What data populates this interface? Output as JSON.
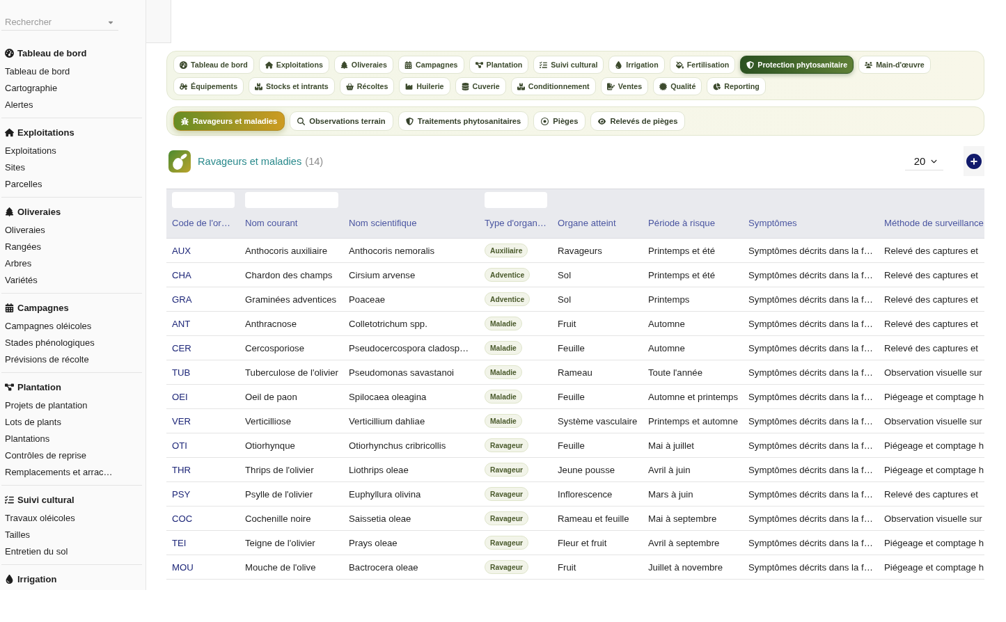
{
  "sidebar": {
    "search": {
      "placeholder": "Rechercher"
    },
    "sections": [
      {
        "title": "Tableau de bord",
        "items": [
          "Tableau de bord",
          "Cartographie",
          "Alertes"
        ]
      },
      {
        "title": "Exploitations",
        "items": [
          "Exploitations",
          "Sites",
          "Parcelles"
        ]
      },
      {
        "title": "Oliveraies",
        "items": [
          "Oliveraies",
          "Rangées",
          "Arbres",
          "Variétés"
        ]
      },
      {
        "title": "Campagnes",
        "items": [
          "Campagnes oléicoles",
          "Stades phénologiques",
          "Prévisions de récolte"
        ]
      },
      {
        "title": "Plantation",
        "items": [
          "Projets de plantation",
          "Lots de plants",
          "Plantations",
          "Contrôles de reprise",
          "Remplacements et arrac…"
        ]
      },
      {
        "title": "Suivi cultural",
        "items": [
          "Travaux oléicoles",
          "Tailles",
          "Entretien du sol"
        ]
      },
      {
        "title": "Irrigation"
      }
    ]
  },
  "module_tabs": [
    {
      "label": "Tableau de bord",
      "selected": false
    },
    {
      "label": "Exploitations",
      "selected": false
    },
    {
      "label": "Oliveraies",
      "selected": false
    },
    {
      "label": "Campagnes",
      "selected": false
    },
    {
      "label": "Plantation",
      "selected": false
    },
    {
      "label": "Suivi cultural",
      "selected": false
    },
    {
      "label": "Irrigation",
      "selected": false
    },
    {
      "label": "Fertilisation",
      "selected": false
    },
    {
      "label": "Protection phytosanitaire",
      "selected": true
    },
    {
      "label": "Main-d'œuvre",
      "selected": false
    },
    {
      "label": "Équipements",
      "selected": false
    },
    {
      "label": "Stocks et intrants",
      "selected": false
    },
    {
      "label": "Récoltes",
      "selected": false
    },
    {
      "label": "Huilerie",
      "selected": false
    },
    {
      "label": "Cuverie",
      "selected": false
    },
    {
      "label": "Conditionnement",
      "selected": false
    },
    {
      "label": "Ventes",
      "selected": false
    },
    {
      "label": "Qualité",
      "selected": false
    },
    {
      "label": "Reporting",
      "selected": false
    }
  ],
  "sub_tabs": [
    {
      "label": "Ravageurs et maladies",
      "selected": true
    },
    {
      "label": "Observations terrain",
      "selected": false
    },
    {
      "label": "Traitements phytosanitaires",
      "selected": false
    },
    {
      "label": "Pièges",
      "selected": false
    },
    {
      "label": "Relevés de pièges",
      "selected": false
    }
  ],
  "list_header": {
    "title": "Ravageurs et maladies",
    "count": "(14)",
    "page_size": "20"
  },
  "table": {
    "columns": [
      {
        "label": "Code de l'or…",
        "filter": true,
        "kind": "link"
      },
      {
        "label": "Nom courant",
        "filter": true,
        "kind": "text"
      },
      {
        "label": "Nom scientifique",
        "filter": false,
        "kind": "text"
      },
      {
        "label": "Type d'organ…",
        "filter": true,
        "kind": "badge"
      },
      {
        "label": "Organe atteint",
        "filter": false,
        "kind": "text"
      },
      {
        "label": "Période à risque",
        "filter": false,
        "kind": "text"
      },
      {
        "label": "Symptômes",
        "filter": false,
        "kind": "text"
      },
      {
        "label": "Méthode de surveillance",
        "filter": false,
        "kind": "text"
      }
    ],
    "rows": [
      [
        "AUX",
        "Anthocoris auxiliaire",
        "Anthocoris nemoralis",
        "Auxiliaire",
        "Ravageurs",
        "Printemps et été",
        "Symptômes décrits dans la f…",
        "Relevé des captures et"
      ],
      [
        "CHA",
        "Chardon des champs",
        "Cirsium arvense",
        "Adventice",
        "Sol",
        "Printemps et été",
        "Symptômes décrits dans la f…",
        "Relevé des captures et"
      ],
      [
        "GRA",
        "Graminées adventices",
        "Poaceae",
        "Adventice",
        "Sol",
        "Printemps",
        "Symptômes décrits dans la f…",
        "Relevé des captures et"
      ],
      [
        "ANT",
        "Anthracnose",
        "Colletotrichum spp.",
        "Maladie",
        "Fruit",
        "Automne",
        "Symptômes décrits dans la f…",
        "Relevé des captures et"
      ],
      [
        "CER",
        "Cercosporiose",
        "Pseudocercospora cladosp…",
        "Maladie",
        "Feuille",
        "Automne",
        "Symptômes décrits dans la f…",
        "Relevé des captures et"
      ],
      [
        "TUB",
        "Tuberculose de l'olivier",
        "Pseudomonas savastanoi",
        "Maladie",
        "Rameau",
        "Toute l'année",
        "Symptômes décrits dans la f…",
        "Observation visuelle sur"
      ],
      [
        "OEI",
        "Oeil de paon",
        "Spilocaea oleagina",
        "Maladie",
        "Feuille",
        "Automne et printemps",
        "Symptômes décrits dans la f…",
        "Piégeage et comptage h"
      ],
      [
        "VER",
        "Verticilliose",
        "Verticillium dahliae",
        "Maladie",
        "Système vasculaire",
        "Printemps et automne",
        "Symptômes décrits dans la f…",
        "Observation visuelle sur"
      ],
      [
        "OTI",
        "Otiorhynque",
        "Otiorhynchus cribricollis",
        "Ravageur",
        "Feuille",
        "Mai à juillet",
        "Symptômes décrits dans la f…",
        "Piégeage et comptage h"
      ],
      [
        "THR",
        "Thrips de l'olivier",
        "Liothrips oleae",
        "Ravageur",
        "Jeune pousse",
        "Avril à juin",
        "Symptômes décrits dans la f…",
        "Piégeage et comptage h"
      ],
      [
        "PSY",
        "Psylle de l'olivier",
        "Euphyllura olivina",
        "Ravageur",
        "Inflorescence",
        "Mars à juin",
        "Symptômes décrits dans la f…",
        "Relevé des captures et"
      ],
      [
        "COC",
        "Cochenille noire",
        "Saissetia oleae",
        "Ravageur",
        "Rameau et feuille",
        "Mai à septembre",
        "Symptômes décrits dans la f…",
        "Observation visuelle sur"
      ],
      [
        "TEI",
        "Teigne de l'olivier",
        "Prays oleae",
        "Ravageur",
        "Fleur et fruit",
        "Avril à septembre",
        "Symptômes décrits dans la f…",
        "Piégeage et comptage h"
      ],
      [
        "MOU",
        "Mouche de l'olive",
        "Bactrocera oleae",
        "Ravageur",
        "Fruit",
        "Juillet à novembre",
        "Symptômes décrits dans la f…",
        "Piégeage et comptage h"
      ]
    ]
  }
}
